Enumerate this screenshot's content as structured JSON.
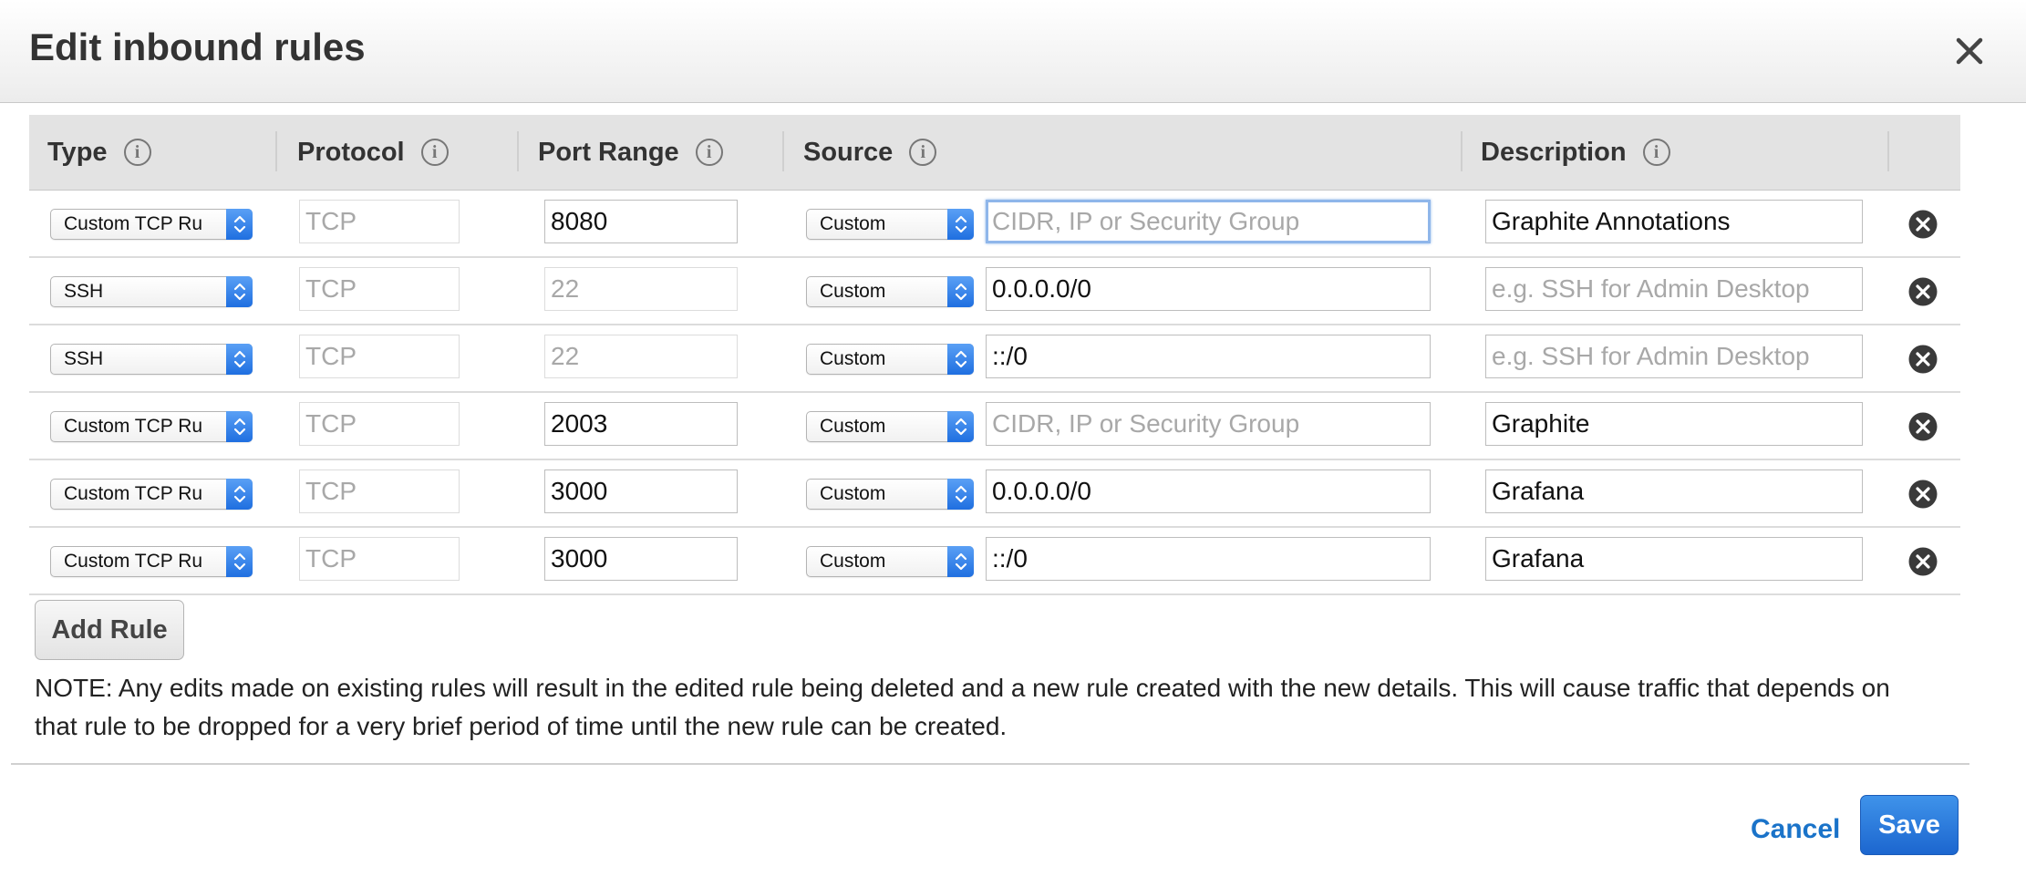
{
  "modal": {
    "title": "Edit inbound rules",
    "close_icon": "close-icon"
  },
  "table": {
    "headers": {
      "type": "Type",
      "protocol": "Protocol",
      "port_range": "Port Range",
      "source": "Source",
      "description": "Description"
    },
    "info_icon": "i",
    "rows": [
      {
        "type": "Custom TCP Ru",
        "protocol": "TCP",
        "port_range": "8080",
        "source_type": "Custom",
        "source_value": "",
        "source_placeholder": "CIDR, IP or Security Group",
        "description": "Graphite Annotations",
        "description_placeholder": "e.g. SSH for Admin Desktop"
      },
      {
        "type": "SSH",
        "protocol": "TCP",
        "port_range": "22",
        "source_type": "Custom",
        "source_value": "0.0.0.0/0",
        "source_placeholder": "CIDR, IP or Security Group",
        "description": "",
        "description_placeholder": "e.g. SSH for Admin Desktop"
      },
      {
        "type": "SSH",
        "protocol": "TCP",
        "port_range": "22",
        "source_type": "Custom",
        "source_value": "::/0",
        "source_placeholder": "CIDR, IP or Security Group",
        "description": "",
        "description_placeholder": "e.g. SSH for Admin Desktop"
      },
      {
        "type": "Custom TCP Ru",
        "protocol": "TCP",
        "port_range": "2003",
        "source_type": "Custom",
        "source_value": "",
        "source_placeholder": "CIDR, IP or Security Group",
        "description": "Graphite",
        "description_placeholder": "e.g. SSH for Admin Desktop"
      },
      {
        "type": "Custom TCP Ru",
        "protocol": "TCP",
        "port_range": "3000",
        "source_type": "Custom",
        "source_value": "0.0.0.0/0",
        "source_placeholder": "CIDR, IP or Security Group",
        "description": "Grafana",
        "description_placeholder": "e.g. SSH for Admin Desktop"
      },
      {
        "type": "Custom TCP Ru",
        "protocol": "TCP",
        "port_range": "3000",
        "source_type": "Custom",
        "source_value": "::/0",
        "source_placeholder": "CIDR, IP or Security Group",
        "description": "Grafana",
        "description_placeholder": "e.g. SSH for Admin Desktop"
      }
    ]
  },
  "actions": {
    "add_rule_label": "Add Rule",
    "cancel_label": "Cancel",
    "save_label": "Save"
  },
  "note": "NOTE: Any edits made on existing rules will result in the edited rule being deleted and a new rule created with the new details. This will cause traffic that depends on that rule to be dropped for a very brief period of time until the new rule can be created.",
  "colors": {
    "accent": "#1a73c9",
    "save_button": "#2b7de0",
    "select_arrow": "#2f80ea"
  }
}
